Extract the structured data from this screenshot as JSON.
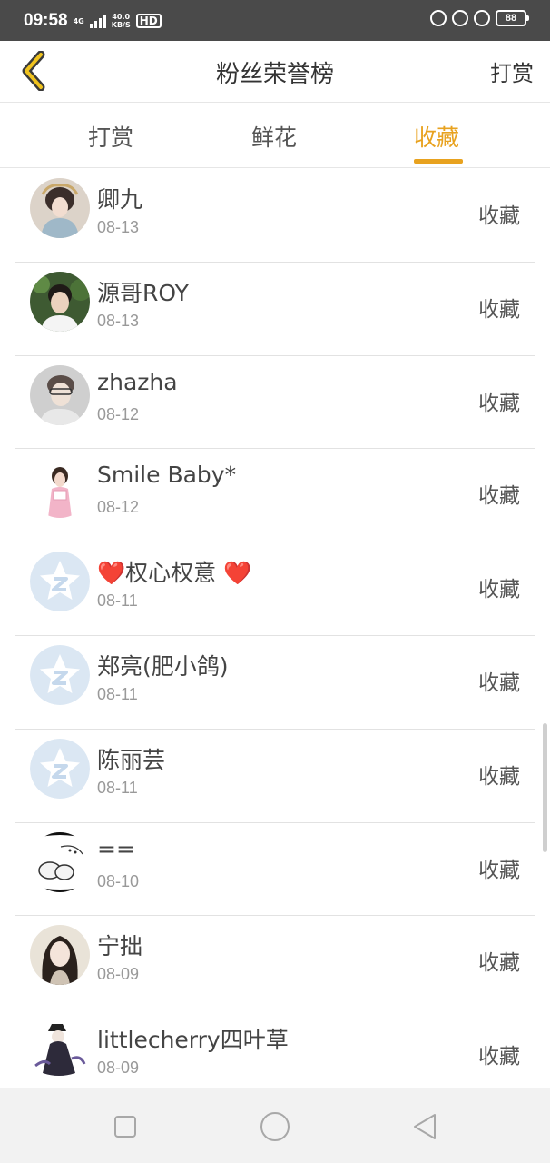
{
  "status_bar": {
    "time": "09:58",
    "net_type": "4G",
    "speed_value": "40.0",
    "speed_unit": "KB/S",
    "hd": "HD",
    "battery": "88"
  },
  "header": {
    "title": "粉丝荣誉榜",
    "right_action": "打赏"
  },
  "tabs": [
    {
      "label": "打赏",
      "active": false
    },
    {
      "label": "鲜花",
      "active": false
    },
    {
      "label": "收藏",
      "active": true
    }
  ],
  "accent_color": "#e8a21f",
  "fans": [
    {
      "name": "卿九",
      "date": "08-13",
      "action": "收藏",
      "avatar": "photo-avatar"
    },
    {
      "name": "源哥ROY",
      "date": "08-13",
      "action": "收藏",
      "avatar": "photo-avatar"
    },
    {
      "name": "zhazha",
      "date": "08-12",
      "action": "收藏",
      "avatar": "photo-avatar"
    },
    {
      "name": "Smile Baby*",
      "date": "08-12",
      "action": "收藏",
      "avatar": "photo-avatar"
    },
    {
      "name": "❤️权心权意 ❤️",
      "date": "08-11",
      "action": "收藏",
      "avatar": "default-qq-star-icon"
    },
    {
      "name": "郑亮(肥小鸽)",
      "date": "08-11",
      "action": "收藏",
      "avatar": "default-qq-star-icon"
    },
    {
      "name": "陈丽芸",
      "date": "08-11",
      "action": "收藏",
      "avatar": "default-qq-star-icon"
    },
    {
      "name": "==",
      "date": "08-10",
      "action": "收藏",
      "avatar": "photo-avatar"
    },
    {
      "name": "宁拙",
      "date": "08-09",
      "action": "收藏",
      "avatar": "photo-avatar"
    },
    {
      "name": "littlecherry四叶草",
      "date": "08-09",
      "action": "收藏",
      "avatar": "photo-avatar"
    }
  ],
  "nav_bar": {
    "recent_icon": "square-icon",
    "home_icon": "circle-icon",
    "back_icon": "triangle-back-icon"
  }
}
